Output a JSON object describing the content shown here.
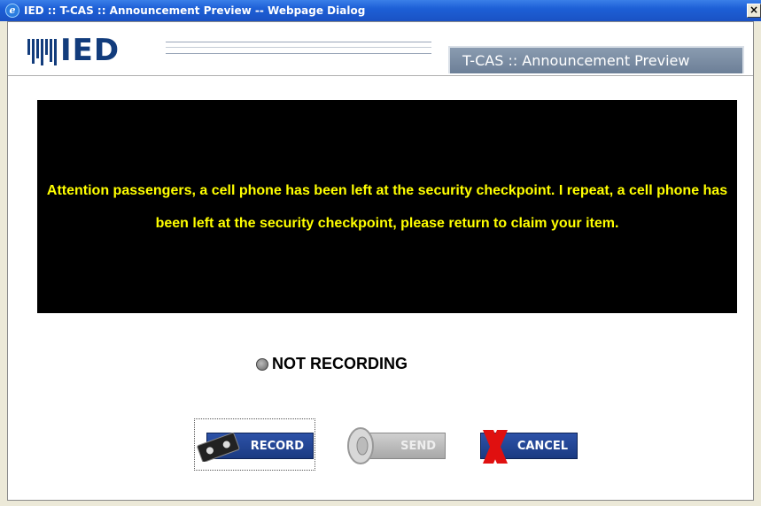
{
  "window": {
    "title": "IED :: T-CAS :: Announcement Preview -- Webpage Dialog",
    "close": "×"
  },
  "header": {
    "logo_text": "IED",
    "tab_title": "T-CAS :: Announcement Preview"
  },
  "announcement": {
    "text": "Attention passengers, a cell phone has been left at the security checkpoint. I repeat, a cell phone has been left at the security checkpoint, please return to claim your item."
  },
  "status": {
    "label": "NOT RECORDING",
    "color": "#808080"
  },
  "buttons": {
    "record": "RECORD",
    "send": "SEND",
    "cancel": "CANCEL"
  },
  "colors": {
    "accent": "#1a3a82",
    "text_yellow": "#ffff00",
    "cancel_x": "#e01010"
  }
}
